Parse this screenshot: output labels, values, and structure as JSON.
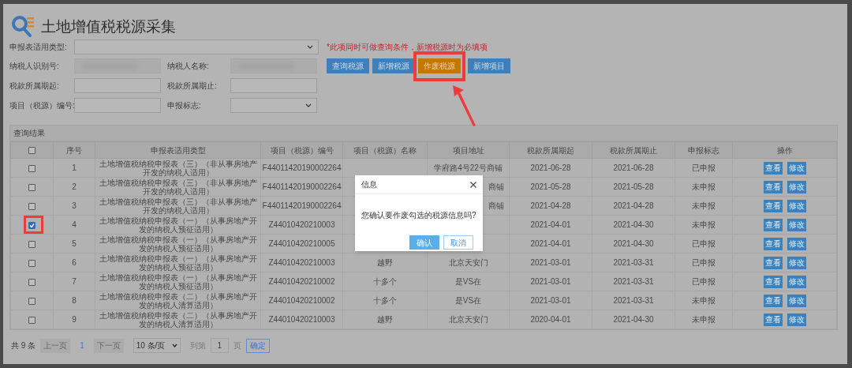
{
  "title": "土地增值税税源采集",
  "form": {
    "report_type": {
      "label": "申报表适用类型:",
      "kind": "select"
    },
    "note": "*此项同时可做查询条件，新增税源时为必填项",
    "taxpayer_id": {
      "label": "纳税人识别号:",
      "kind": "blurred"
    },
    "taxpayer_name": {
      "label": "纳税人名称:",
      "kind": "blurred"
    },
    "period_start": {
      "label": "税款所属期起:",
      "kind": "text"
    },
    "period_end": {
      "label": "税款所属期止:",
      "kind": "text"
    },
    "project_code": {
      "label": "项目（税源）编号:",
      "kind": "text"
    },
    "declare_flag": {
      "label": "申报标志:",
      "kind": "select"
    }
  },
  "buttons": [
    {
      "label": "查询税源",
      "kind": "primary",
      "highlighted": false
    },
    {
      "label": "新增税源",
      "kind": "primary",
      "highlighted": false
    },
    {
      "label": "作废税源",
      "kind": "warning",
      "highlighted": true
    },
    {
      "label": "新增项目",
      "kind": "primary",
      "highlighted": false
    }
  ],
  "table": {
    "title": "查询结果",
    "columns": [
      "序号",
      "申报表适用类型",
      "项目（税源）编号",
      "项目（税源）名称",
      "项目地址",
      "税款所属期起",
      "税款所属期止",
      "申报标志",
      "操作"
    ],
    "header_checked": false,
    "rows": [
      {
        "checked": false,
        "highlighted": false,
        "seq": "1",
        "type": "土地增值税纳税申报表（三）（非从事房地产开发的纳税人适用）",
        "code": "F44011420190002264",
        "address": "学府路4号22号商铺",
        "start": "2021-06-28",
        "end": "2021-06-28",
        "status": "已申报",
        "actions": [
          "查看",
          "修改"
        ]
      },
      {
        "checked": false,
        "highlighted": false,
        "seq": "2",
        "type": "土地增值税纳税申报表（三）（非从事房地产开发的纳税人适用）",
        "code": "F44011420190002264",
        "address": "商铺",
        "address_clipped": true,
        "start": "2021-05-28",
        "end": "2021-05-28",
        "status": "未申报",
        "actions": [
          "查看",
          "修改"
        ]
      },
      {
        "checked": false,
        "highlighted": false,
        "seq": "3",
        "type": "土地增值税纳税申报表（三）（非从事房地产开发的纳税人适用）",
        "code": "F44011420190002264",
        "address": "商铺",
        "address_clipped": true,
        "start": "2021-04-28",
        "end": "2021-04-28",
        "status": "未申报",
        "actions": [
          "查看",
          "修改"
        ]
      },
      {
        "checked": true,
        "highlighted": true,
        "seq": "4",
        "type": "土地增值税纳税申报表（一）（从事房地产开发的纳税人预征适用）",
        "code": "Z44010420210003",
        "start": "2021-04-01",
        "end": "2021-04-30",
        "status": "未申报",
        "actions": [
          "查看",
          "修改"
        ]
      },
      {
        "checked": false,
        "highlighted": false,
        "seq": "5",
        "type": "土地增值税纳税申报表（一）（从事房地产开发的纳税人预征适用）",
        "code": "Z44010420210005",
        "start": "2021-04-01",
        "end": "2021-04-30",
        "status": "已申报",
        "actions": [
          "查看",
          "修改"
        ]
      },
      {
        "checked": false,
        "highlighted": false,
        "seq": "6",
        "type": "土地增值税纳税申报表（一）（从事房地产开发的纳税人预征适用）",
        "code": "Z44010420210003",
        "name": "越野",
        "address": "北京天安门",
        "start": "2021-03-01",
        "end": "2021-03-31",
        "status": "已申报",
        "actions": [
          "查看",
          "修改"
        ]
      },
      {
        "checked": false,
        "highlighted": false,
        "seq": "7",
        "type": "土地增值税纳税申报表（一）（从事房地产开发的纳税人预征适用）",
        "code": "Z44010420210002",
        "name": "十多个",
        "address": "是VS在",
        "start": "2021-03-01",
        "end": "2021-03-31",
        "status": "已申报",
        "actions": [
          "查看",
          "修改"
        ]
      },
      {
        "checked": false,
        "highlighted": false,
        "seq": "8",
        "type": "土地增值税纳税申报表（二）（从事房地产开发的纳税人清算适用）",
        "code": "Z44010420210002",
        "name": "十多个",
        "address": "是VS在",
        "start": "2021-03-01",
        "end": "2021-03-31",
        "status": "未申报",
        "actions": [
          "查看",
          "修改"
        ]
      },
      {
        "checked": false,
        "highlighted": false,
        "seq": "9",
        "type": "土地增值税纳税申报表（二）（从事房地产开发的纳税人清算适用）",
        "code": "Z44010420210003",
        "name": "越野",
        "address": "北京天安门",
        "start": "2020-04-01",
        "end": "2021-04-30",
        "status": "未申报",
        "actions": [
          "查看",
          "修改"
        ]
      }
    ]
  },
  "pagination": {
    "total": "共 9 条",
    "prev": {
      "label": "上一页",
      "disabled": true
    },
    "page": "1",
    "next": {
      "label": "下一页",
      "disabled": true
    },
    "page_size": "10 条/页",
    "goto_label": "到第",
    "goto_value": "1",
    "page_label": "页",
    "confirm": "确定"
  },
  "dialog": {
    "title": "信息",
    "message": "您确认要作废勾选的税源信息吗?",
    "buttons": [
      {
        "label": "确认",
        "kind": "primary"
      },
      {
        "label": "取消",
        "kind": "secondary"
      }
    ]
  }
}
